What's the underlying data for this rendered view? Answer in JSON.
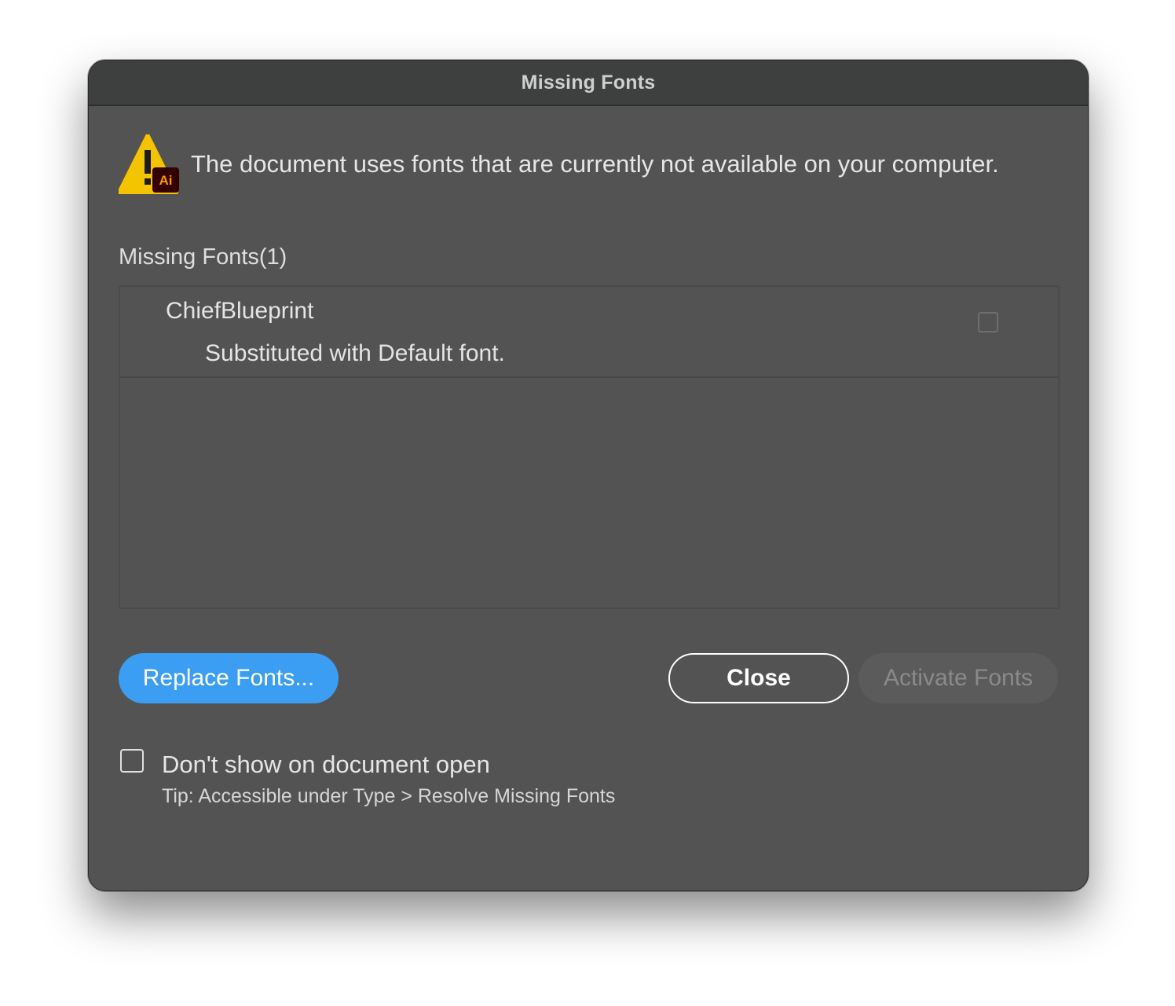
{
  "dialog": {
    "title": "Missing Fonts",
    "message": "The document uses fonts that are currently not available on your computer.",
    "icon": "warning-triangle-with-ai-badge-icon",
    "icon_badge_text": "Ai"
  },
  "missing_fonts": {
    "section_label": "Missing Fonts(1)",
    "items": [
      {
        "name": "ChiefBlueprint",
        "status": "Substituted with Default font.",
        "checked": false
      }
    ]
  },
  "buttons": {
    "replace_label": "Replace Fonts...",
    "close_label": "Close",
    "activate_label": "Activate Fonts"
  },
  "options": {
    "dont_show_label": "Don't show on document open",
    "dont_show_checked": false,
    "tip": "Tip: Accessible under Type > Resolve Missing Fonts"
  },
  "colors": {
    "accent": "#3c9ef3",
    "dialog_bg": "#535353",
    "titlebar_bg": "#3e3f3f",
    "warning_yellow": "#f5c400",
    "ai_badge_bg": "#330000",
    "ai_badge_text": "#ff9a00"
  }
}
